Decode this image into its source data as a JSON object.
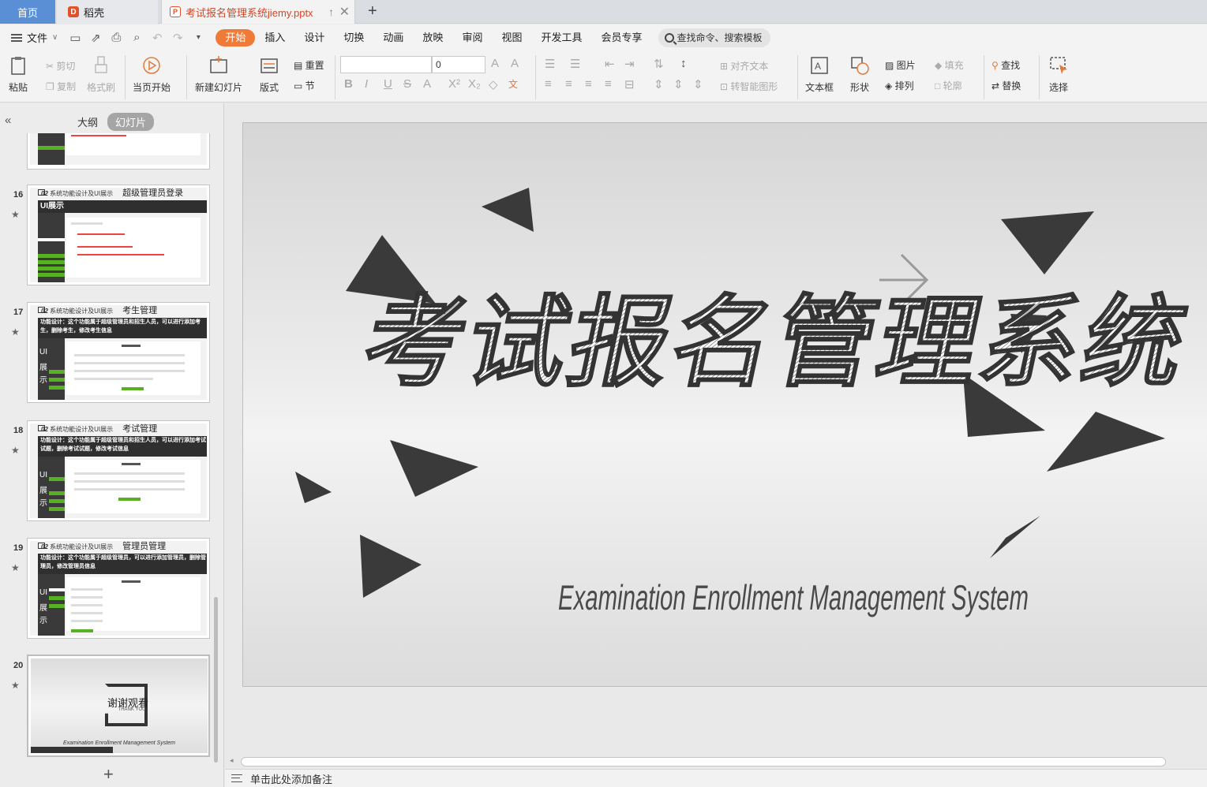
{
  "tabs": {
    "home": "首页",
    "daoke": "稻壳",
    "document": "考试报名管理系统jiemy.pptx"
  },
  "menu": {
    "file": "文件",
    "tabs": [
      "开始",
      "插入",
      "设计",
      "切换",
      "动画",
      "放映",
      "审阅",
      "视图",
      "开发工具",
      "会员专享"
    ],
    "active_tab": "开始",
    "search": "查找命令、搜索模板"
  },
  "ribbon": {
    "paste": "粘贴",
    "cut": "剪切",
    "copy": "复制",
    "format_painter": "格式刷",
    "play_from_current": "当页开始",
    "new_slide": "新建幻灯片",
    "layout": "版式",
    "reset": "重置",
    "section": "节",
    "font_name": "",
    "font_size": "0",
    "align_text": "对齐文本",
    "smart_shape": "转智能图形",
    "textbox": "文本框",
    "shape": "形状",
    "picture": "图片",
    "arrange": "排列",
    "fill": "填充",
    "outline": "轮廓",
    "find": "查找",
    "replace": "替换",
    "select": "选择"
  },
  "left_panel": {
    "outline_tab": "大纲",
    "slides_tab": "幻灯片",
    "thumbnails": [
      {
        "num": "16",
        "chapter": "02",
        "section": "系统功能设计及UI展示",
        "title": "超级管理员登录",
        "bar": "UI展示"
      },
      {
        "num": "17",
        "chapter": "02",
        "section": "系统功能设计及UI展示",
        "title": "考生管理",
        "bar": "功能设计：这个功能属于超级管理员和招生人员，可以进行添加考生，删除考生，修改考生信息"
      },
      {
        "num": "18",
        "chapter": "02",
        "section": "系统功能设计及UI展示",
        "title": "考试管理",
        "bar": "功能设计：这个功能属于超级管理员和招生人员，可以进行添加考试试题，删除考试试题，修改考试信息"
      },
      {
        "num": "19",
        "chapter": "02",
        "section": "系统功能设计及UI展示",
        "title": "管理员管理",
        "bar": "功能设计：这个功能属于超级管理员，可以进行添加管理员，删除管理员，修改管理员信息"
      },
      {
        "num": "20",
        "thanks": "谢谢观看",
        "thanks_en": "THANK YOU",
        "footer": "Examination Enrollment Management System"
      }
    ]
  },
  "slide": {
    "title": "考试报名管理系统",
    "subtitle": "Examination Enrollment Management System"
  },
  "notes_placeholder": "单击此处添加备注",
  "colors": {
    "accent": "#f07b39",
    "home_tab": "#5a8fd6",
    "doc_tab_text": "#d24726",
    "shape_dark": "#3a3a3a"
  }
}
